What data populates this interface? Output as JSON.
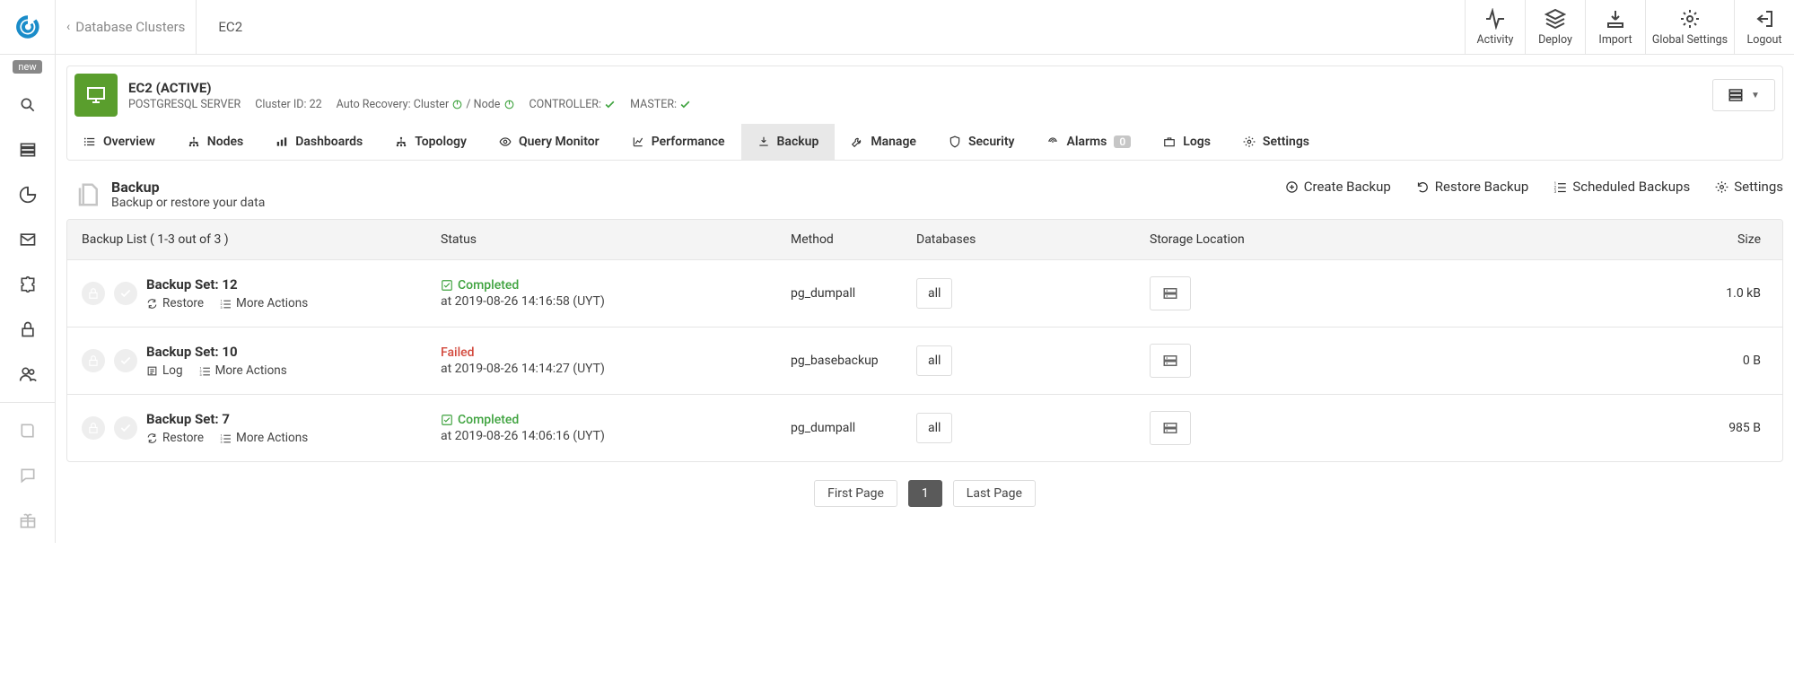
{
  "topbar": {
    "breadcrumb_label": "Database Clusters",
    "cluster_name": "EC2",
    "actions": {
      "activity": "Activity",
      "deploy": "Deploy",
      "import": "Import",
      "global_settings": "Global Settings",
      "logout": "Logout"
    }
  },
  "leftrail": {
    "new_tag": "new"
  },
  "cluster": {
    "title": "EC2 (ACTIVE)",
    "subtitle_type": "POSTGRESQL SERVER",
    "cluster_id_label": "Cluster ID: 22",
    "auto_recovery_label": "Auto Recovery: Cluster",
    "node_label": "/ Node",
    "controller_label": "CONTROLLER:",
    "master_label": "MASTER:"
  },
  "tabs": {
    "overview": "Overview",
    "nodes": "Nodes",
    "dashboards": "Dashboards",
    "topology": "Topology",
    "query_monitor": "Query Monitor",
    "performance": "Performance",
    "backup": "Backup",
    "manage": "Manage",
    "security": "Security",
    "alarms": "Alarms",
    "alarms_count": "0",
    "logs": "Logs",
    "settings": "Settings"
  },
  "section": {
    "title": "Backup",
    "subtitle": "Backup or restore your data",
    "create": "Create Backup",
    "restore": "Restore Backup",
    "scheduled": "Scheduled Backups",
    "settings": "Settings"
  },
  "table": {
    "headers": {
      "list": "Backup List ( 1-3 out of 3 )",
      "status": "Status",
      "method": "Method",
      "databases": "Databases",
      "storage": "Storage Location",
      "size": "Size"
    },
    "rows": [
      {
        "set_title": "Backup Set: 12",
        "link1_label": "Restore",
        "link1_icon": "refresh-icon",
        "link2_label": "More Actions",
        "status_kind": "ok",
        "status_text": "Completed",
        "status_time": "at 2019-08-26 14:16:58 (UYT)",
        "method": "pg_dumpall",
        "db": "all",
        "size": "1.0 kB"
      },
      {
        "set_title": "Backup Set: 10",
        "link1_label": "Log",
        "link1_icon": "log-icon",
        "link2_label": "More Actions",
        "status_kind": "fail",
        "status_text": "Failed",
        "status_time": "at 2019-08-26 14:14:27 (UYT)",
        "method": "pg_basebackup",
        "db": "all",
        "size": "0 B"
      },
      {
        "set_title": "Backup Set: 7",
        "link1_label": "Restore",
        "link1_icon": "refresh-icon",
        "link2_label": "More Actions",
        "status_kind": "ok",
        "status_text": "Completed",
        "status_time": "at 2019-08-26 14:06:16 (UYT)",
        "method": "pg_dumpall",
        "db": "all",
        "size": "985 B"
      }
    ]
  },
  "pager": {
    "first": "First Page",
    "current": "1",
    "last": "Last Page"
  }
}
